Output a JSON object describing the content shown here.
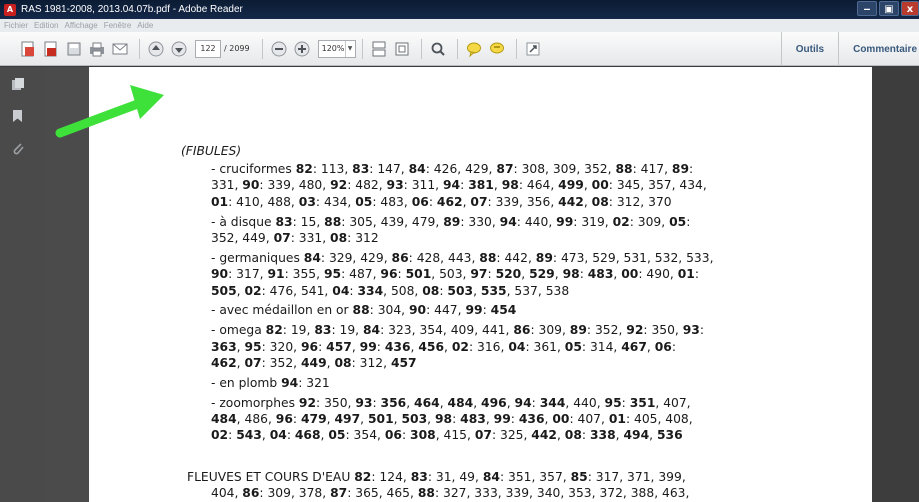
{
  "window": {
    "title": "RAS 1981-2008, 2013.04.07b.pdf - Adobe Reader",
    "controls": [
      "‒",
      "▣",
      "x"
    ]
  },
  "menu": {
    "items": [
      "Fichier",
      "Edition",
      "Affichage",
      "Fenêtre",
      "Aide"
    ]
  },
  "toolbar": {
    "page_current": "122",
    "page_total": "/ 2099",
    "zoom": "120%",
    "tools_label": "Outils",
    "comment_label": "Commentaire"
  },
  "colors": {
    "arrow": "#3ee03a",
    "titlebar": "#0b1b33"
  },
  "document": {
    "heading": "(FIBULES)",
    "entries": [
      {
        "lines": [
          [
            [
              "n",
              "- cruciformes "
            ],
            [
              "b",
              "82"
            ],
            [
              "n",
              ": 113, "
            ],
            [
              "b",
              "83"
            ],
            [
              "n",
              ": 147, "
            ],
            [
              "b",
              "84"
            ],
            [
              "n",
              ": 426, 429, "
            ],
            [
              "b",
              "87"
            ],
            [
              "n",
              ": 308, 309, 352, "
            ],
            [
              "b",
              "88"
            ],
            [
              "n",
              ": 417, "
            ],
            [
              "b",
              "89"
            ],
            [
              "n",
              ":"
            ]
          ],
          [
            [
              "n",
              "331, "
            ],
            [
              "b",
              "90"
            ],
            [
              "n",
              ": 339, 480, "
            ],
            [
              "b",
              "92"
            ],
            [
              "n",
              ": 482, "
            ],
            [
              "b",
              "93"
            ],
            [
              "n",
              ": 311, "
            ],
            [
              "b",
              "94"
            ],
            [
              "n",
              ": "
            ],
            [
              "b",
              "381"
            ],
            [
              "n",
              ", "
            ],
            [
              "b",
              "98"
            ],
            [
              "n",
              ": 464, "
            ],
            [
              "b",
              "499"
            ],
            [
              "n",
              ", "
            ],
            [
              "b",
              "00"
            ],
            [
              "n",
              ": 345, 357, 434,"
            ]
          ],
          [
            [
              "b",
              "01"
            ],
            [
              "n",
              ": 410, 488, "
            ],
            [
              "b",
              "03"
            ],
            [
              "n",
              ": 434, "
            ],
            [
              "b",
              "05"
            ],
            [
              "n",
              ": 483, "
            ],
            [
              "b",
              "06"
            ],
            [
              "n",
              ": "
            ],
            [
              "b",
              "462"
            ],
            [
              "n",
              ", "
            ],
            [
              "b",
              "07"
            ],
            [
              "n",
              ": 339, 356, "
            ],
            [
              "b",
              "442"
            ],
            [
              "n",
              ", "
            ],
            [
              "b",
              "08"
            ],
            [
              "n",
              ": 312, 370"
            ]
          ]
        ]
      },
      {
        "lines": [
          [
            [
              "n",
              "- à disque "
            ],
            [
              "b",
              "83"
            ],
            [
              "n",
              ": 15, "
            ],
            [
              "b",
              "88"
            ],
            [
              "n",
              ": 305, 439, 479, "
            ],
            [
              "b",
              "89"
            ],
            [
              "n",
              ": 330, "
            ],
            [
              "b",
              "94"
            ],
            [
              "n",
              ": 440, "
            ],
            [
              "b",
              "99"
            ],
            [
              "n",
              ": 319, "
            ],
            [
              "b",
              "02"
            ],
            [
              "n",
              ": 309, "
            ],
            [
              "b",
              "05"
            ],
            [
              "n",
              ":"
            ]
          ],
          [
            [
              "n",
              "352, 449, "
            ],
            [
              "b",
              "07"
            ],
            [
              "n",
              ": 331, "
            ],
            [
              "b",
              "08"
            ],
            [
              "n",
              ": 312"
            ]
          ]
        ]
      },
      {
        "lines": [
          [
            [
              "n",
              "- germaniques "
            ],
            [
              "b",
              "84"
            ],
            [
              "n",
              ": 329, 429, "
            ],
            [
              "b",
              "86"
            ],
            [
              "n",
              ": 428, 443, "
            ],
            [
              "b",
              "88"
            ],
            [
              "n",
              ": 442, "
            ],
            [
              "b",
              "89"
            ],
            [
              "n",
              ": 473, 529, 531, 532, 533,"
            ]
          ],
          [
            [
              "b",
              "90"
            ],
            [
              "n",
              ": 317, "
            ],
            [
              "b",
              "91"
            ],
            [
              "n",
              ": 355, "
            ],
            [
              "b",
              "95"
            ],
            [
              "n",
              ": 487, "
            ],
            [
              "b",
              "96"
            ],
            [
              "n",
              ": "
            ],
            [
              "b",
              "501"
            ],
            [
              "n",
              ", 503, "
            ],
            [
              "b",
              "97"
            ],
            [
              "n",
              ": "
            ],
            [
              "b",
              "520"
            ],
            [
              "n",
              ", "
            ],
            [
              "b",
              "529"
            ],
            [
              "n",
              ", "
            ],
            [
              "b",
              "98"
            ],
            [
              "n",
              ": "
            ],
            [
              "b",
              "483"
            ],
            [
              "n",
              ", "
            ],
            [
              "b",
              "00"
            ],
            [
              "n",
              ": 490, "
            ],
            [
              "b",
              "01"
            ],
            [
              "n",
              ":"
            ]
          ],
          [
            [
              "b",
              "505"
            ],
            [
              "n",
              ", "
            ],
            [
              "b",
              "02"
            ],
            [
              "n",
              ": 476, 541, "
            ],
            [
              "b",
              "04"
            ],
            [
              "n",
              ": "
            ],
            [
              "b",
              "334"
            ],
            [
              "n",
              ", 508, "
            ],
            [
              "b",
              "08"
            ],
            [
              "n",
              ": "
            ],
            [
              "b",
              "503"
            ],
            [
              "n",
              ", "
            ],
            [
              "b",
              "535"
            ],
            [
              "n",
              ", 537, 538"
            ]
          ]
        ]
      },
      {
        "lines": [
          [
            [
              "n",
              "- avec médaillon en or "
            ],
            [
              "b",
              "88"
            ],
            [
              "n",
              ": 304, "
            ],
            [
              "b",
              "90"
            ],
            [
              "n",
              ": 447, "
            ],
            [
              "b",
              "99"
            ],
            [
              "n",
              ": "
            ],
            [
              "b",
              "454"
            ]
          ]
        ]
      },
      {
        "lines": [
          [
            [
              "n",
              "- omega "
            ],
            [
              "b",
              "82"
            ],
            [
              "n",
              ": 19, "
            ],
            [
              "b",
              "83"
            ],
            [
              "n",
              ": 19, "
            ],
            [
              "b",
              "84"
            ],
            [
              "n",
              ": 323, 354, 409, 441, "
            ],
            [
              "b",
              "86"
            ],
            [
              "n",
              ": 309, "
            ],
            [
              "b",
              "89"
            ],
            [
              "n",
              ": 352, "
            ],
            [
              "b",
              "92"
            ],
            [
              "n",
              ": 350, "
            ],
            [
              "b",
              "93"
            ],
            [
              "n",
              ":"
            ]
          ],
          [
            [
              "b",
              "363"
            ],
            [
              "n",
              ", "
            ],
            [
              "b",
              "95"
            ],
            [
              "n",
              ": 320, "
            ],
            [
              "b",
              "96"
            ],
            [
              "n",
              ": "
            ],
            [
              "b",
              "457"
            ],
            [
              "n",
              ", "
            ],
            [
              "b",
              "99"
            ],
            [
              "n",
              ": "
            ],
            [
              "b",
              "436"
            ],
            [
              "n",
              ", "
            ],
            [
              "b",
              "456"
            ],
            [
              "n",
              ", "
            ],
            [
              "b",
              "02"
            ],
            [
              "n",
              ": 316, "
            ],
            [
              "b",
              "04"
            ],
            [
              "n",
              ": 361, "
            ],
            [
              "b",
              "05"
            ],
            [
              "n",
              ": 314, "
            ],
            [
              "b",
              "467"
            ],
            [
              "n",
              ", "
            ],
            [
              "b",
              "06"
            ],
            [
              "n",
              ":"
            ]
          ],
          [
            [
              "b",
              "462"
            ],
            [
              "n",
              ", "
            ],
            [
              "b",
              "07"
            ],
            [
              "n",
              ": 352, "
            ],
            [
              "b",
              "449"
            ],
            [
              "n",
              ", "
            ],
            [
              "b",
              "08"
            ],
            [
              "n",
              ": 312, "
            ],
            [
              "b",
              "457"
            ]
          ]
        ]
      },
      {
        "lines": [
          [
            [
              "n",
              "- en plomb "
            ],
            [
              "b",
              "94"
            ],
            [
              "n",
              ": 321"
            ]
          ]
        ]
      },
      {
        "lines": [
          [
            [
              "n",
              "- zoomorphes "
            ],
            [
              "b",
              "92"
            ],
            [
              "n",
              ": 350, "
            ],
            [
              "b",
              "93"
            ],
            [
              "n",
              ": "
            ],
            [
              "b",
              "356"
            ],
            [
              "n",
              ", "
            ],
            [
              "b",
              "464"
            ],
            [
              "n",
              ", "
            ],
            [
              "b",
              "484"
            ],
            [
              "n",
              ", "
            ],
            [
              "b",
              "496"
            ],
            [
              "n",
              ", "
            ],
            [
              "b",
              "94"
            ],
            [
              "n",
              ": "
            ],
            [
              "b",
              "344"
            ],
            [
              "n",
              ", 440, "
            ],
            [
              "b",
              "95"
            ],
            [
              "n",
              ": "
            ],
            [
              "b",
              "351"
            ],
            [
              "n",
              ", 407,"
            ]
          ],
          [
            [
              "b",
              "484"
            ],
            [
              "n",
              ", 486, "
            ],
            [
              "b",
              "96"
            ],
            [
              "n",
              ": "
            ],
            [
              "b",
              "479"
            ],
            [
              "n",
              ", "
            ],
            [
              "b",
              "497"
            ],
            [
              "n",
              ", "
            ],
            [
              "b",
              "501"
            ],
            [
              "n",
              ", "
            ],
            [
              "b",
              "503"
            ],
            [
              "n",
              ", "
            ],
            [
              "b",
              "98"
            ],
            [
              "n",
              ": "
            ],
            [
              "b",
              "483"
            ],
            [
              "n",
              ", "
            ],
            [
              "b",
              "99"
            ],
            [
              "n",
              ": "
            ],
            [
              "b",
              "436"
            ],
            [
              "n",
              ", "
            ],
            [
              "b",
              "00"
            ],
            [
              "n",
              ": 407, "
            ],
            [
              "b",
              "01"
            ],
            [
              "n",
              ": 405, 408,"
            ]
          ],
          [
            [
              "b",
              "02"
            ],
            [
              "n",
              ": "
            ],
            [
              "b",
              "543"
            ],
            [
              "n",
              ", "
            ],
            [
              "b",
              "04"
            ],
            [
              "n",
              ": "
            ],
            [
              "b",
              "468"
            ],
            [
              "n",
              ", "
            ],
            [
              "b",
              "05"
            ],
            [
              "n",
              ": 354, "
            ],
            [
              "b",
              "06"
            ],
            [
              "n",
              ": "
            ],
            [
              "b",
              "308"
            ],
            [
              "n",
              ", 415, "
            ],
            [
              "b",
              "07"
            ],
            [
              "n",
              ": 325, "
            ],
            [
              "b",
              "442"
            ],
            [
              "n",
              ", "
            ],
            [
              "b",
              "08"
            ],
            [
              "n",
              ": "
            ],
            [
              "b",
              "338"
            ],
            [
              "n",
              ", "
            ],
            [
              "b",
              "494"
            ],
            [
              "n",
              ", "
            ],
            [
              "b",
              "536"
            ]
          ]
        ]
      }
    ],
    "next_entry": {
      "lines": [
        [
          [
            "n",
            "FLEUVES ET COURS D'EAU "
          ],
          [
            "b",
            "82"
          ],
          [
            "n",
            ": 124, "
          ],
          [
            "b",
            "83"
          ],
          [
            "n",
            ": 31, 49, "
          ],
          [
            "b",
            "84"
          ],
          [
            "n",
            ": 351, 357, "
          ],
          [
            "b",
            "85"
          ],
          [
            "n",
            ": 317, 371, 399,"
          ]
        ],
        [
          [
            "n",
            "404, "
          ],
          [
            "b",
            "86"
          ],
          [
            "n",
            ": 309, 378, "
          ],
          [
            "b",
            "87"
          ],
          [
            "n",
            ": 365, 465, "
          ],
          [
            "b",
            "88"
          ],
          [
            "n",
            ": 327, 333, 339, 340, 353, 372, 388, 463,"
          ]
        ]
      ]
    }
  }
}
